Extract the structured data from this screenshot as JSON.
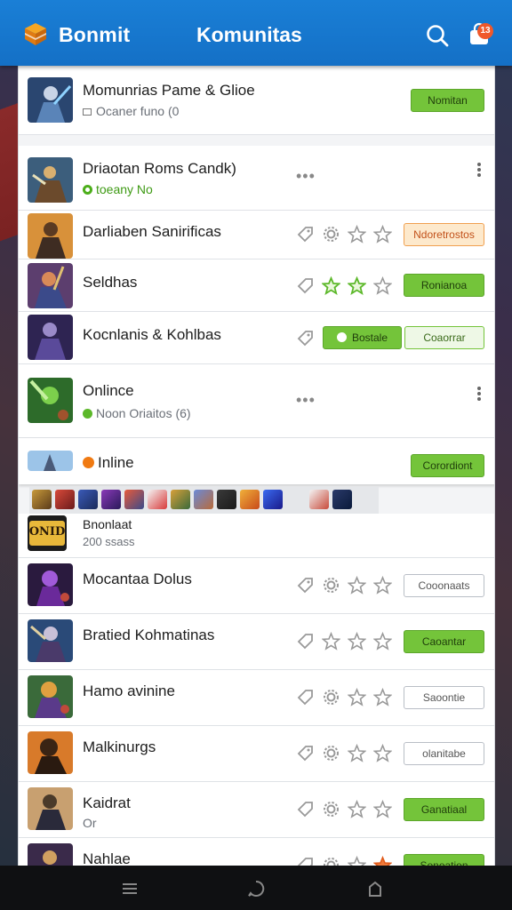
{
  "header": {
    "brand": "Bonmit",
    "title": "Komunitas",
    "notification_count": "13",
    "colors": {
      "bar": "#1577cc",
      "accent_green": "#74c43a",
      "accent_orange": "#f0582a"
    }
  },
  "rows": [
    {
      "name": "Momunrias Pame & Glioe",
      "sub": "Ocaner funo (0",
      "button": "Nomitan"
    },
    {
      "name": "Driaotan Roms Candk)",
      "sub": "toeany No"
    },
    {
      "name": "Darliaben Sanirificas",
      "button": "Ndoretrostos"
    },
    {
      "name": "Seldhas",
      "button": "Ronianoa"
    },
    {
      "name": "Kocnlanis & Kohlbas",
      "button": "Bostale",
      "button2": "Coaorrar"
    },
    {
      "name": "Onlince",
      "sub": "Noon Oriaitos (6)"
    },
    {
      "name": "Inline",
      "button": "Corordiont"
    },
    {
      "name": "Bnonlaat",
      "sub": "200 ssass",
      "logo_text": "ONID"
    },
    {
      "name": "Mocantaa Dolus",
      "button": "Cooonaats"
    },
    {
      "name": "Bratied Kohmatinas",
      "button": "Caoantar"
    },
    {
      "name": "Hamo avinine",
      "button": "Saoontie"
    },
    {
      "name": "Malkinurgs",
      "button": "olanitabe"
    },
    {
      "name": "Kaidrat",
      "sub": "Or",
      "button": "Ganatiaal"
    },
    {
      "name": "Nahlae",
      "button": "Sonoation"
    }
  ],
  "icons": [
    "logo-cube-icon",
    "search-icon",
    "shopping-bag-icon",
    "tag-icon",
    "gear-icon",
    "star-icon",
    "more-icon",
    "menu-icon",
    "home-icon",
    "back-icon"
  ]
}
